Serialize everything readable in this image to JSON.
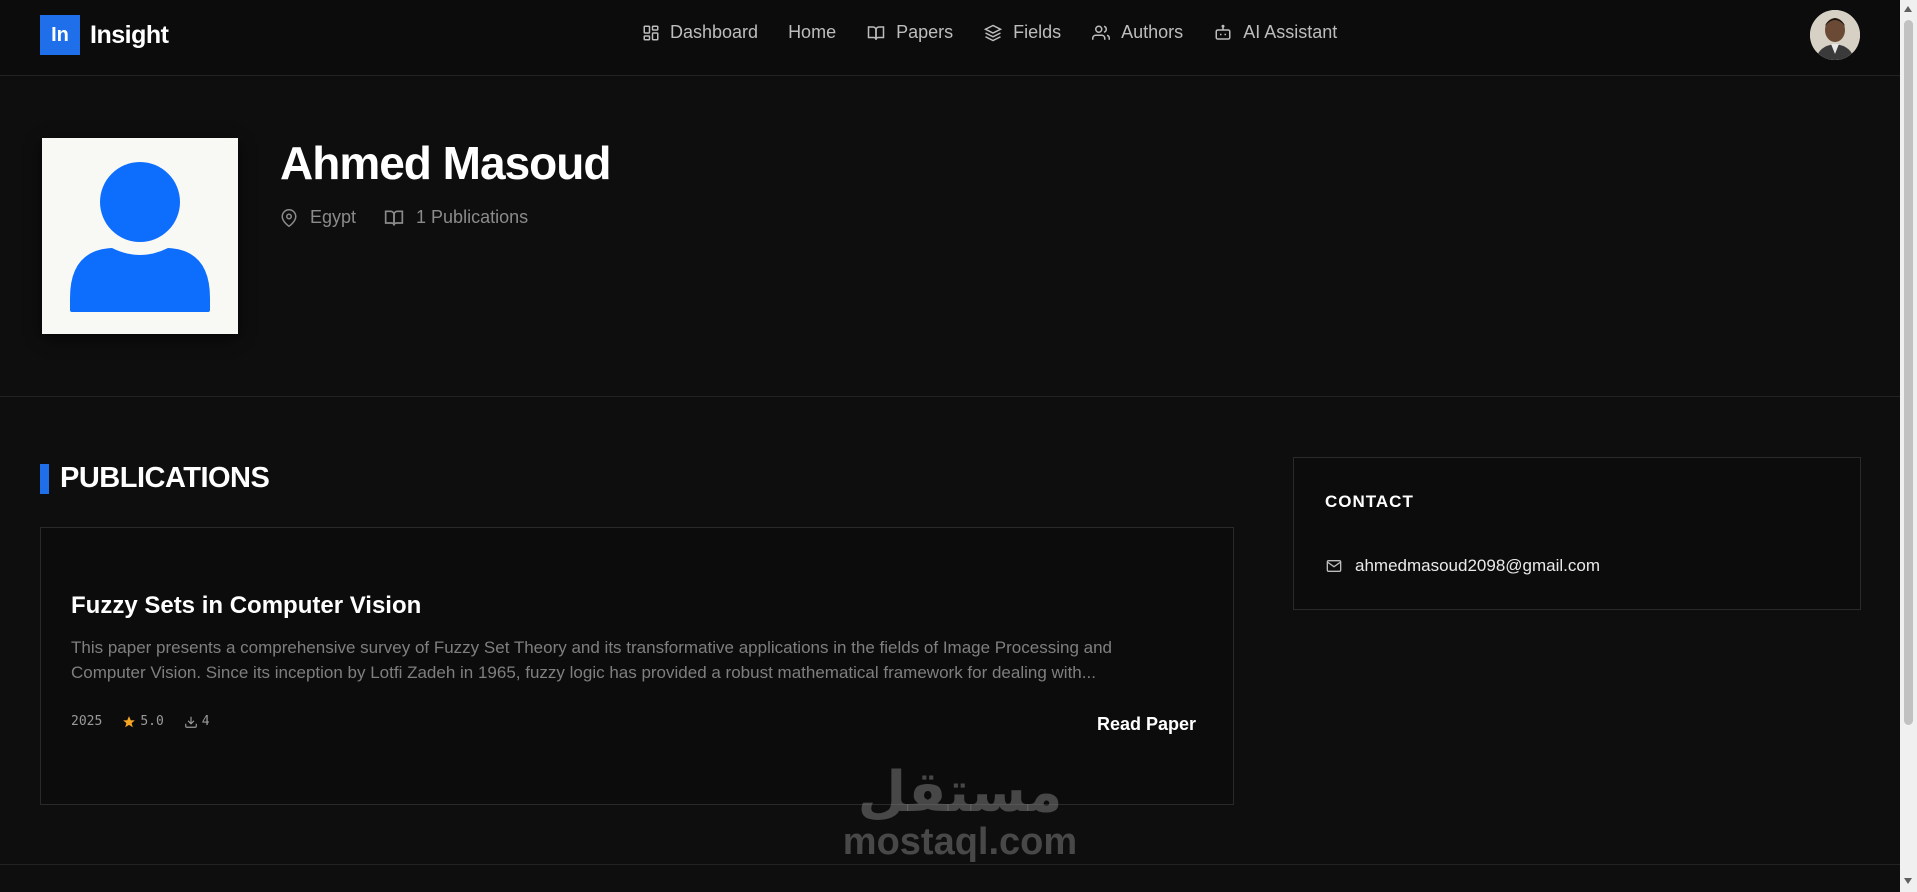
{
  "brand": {
    "badge": "In",
    "name": "Insight"
  },
  "nav": {
    "dashboard": "Dashboard",
    "home": "Home",
    "papers": "Papers",
    "fields": "Fields",
    "authors": "Authors",
    "ai_assistant": "AI Assistant"
  },
  "profile": {
    "name": "Ahmed Masoud",
    "location": "Egypt",
    "publications_count": "1 Publications"
  },
  "publications": {
    "heading": "PUBLICATIONS",
    "items": [
      {
        "title": "Fuzzy Sets in Computer Vision",
        "description": "This paper presents a comprehensive survey of Fuzzy Set Theory and its transformative applications in the fields of Image Processing and Computer Vision. Since its inception by Lotfi Zadeh in 1965, fuzzy logic has provided a robust mathematical framework for dealing with...",
        "year": "2025",
        "rating": "5.0",
        "downloads": "4",
        "action": "Read Paper"
      }
    ]
  },
  "contact": {
    "title": "CONTACT",
    "email": "ahmedmasoud2098@gmail.com"
  },
  "watermark": {
    "arabic": "مستقل",
    "latin": "mostaql.com"
  },
  "colors": {
    "accent": "#1f6feb",
    "background": "#0e0e0e",
    "star": "#f5a623"
  }
}
